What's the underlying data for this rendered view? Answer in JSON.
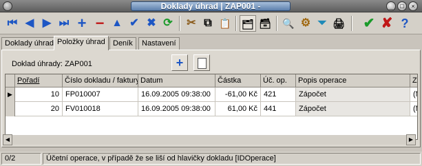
{
  "window": {
    "title": "Doklady úhrad | ZAP001 -",
    "controls": [
      "_",
      "□",
      "×"
    ]
  },
  "toolbar": {
    "buttons": [
      {
        "name": "first-record",
        "glyph": "⏮"
      },
      {
        "name": "prev-record",
        "glyph": "◀"
      },
      {
        "name": "next-record",
        "glyph": "▶"
      },
      {
        "name": "last-record",
        "glyph": "⏭"
      },
      {
        "name": "add-record",
        "glyph": "+"
      },
      {
        "name": "delete-record",
        "glyph": "−"
      },
      {
        "name": "edit-record",
        "glyph": "▲"
      },
      {
        "name": "post-record",
        "glyph": "✔"
      },
      {
        "name": "cancel-record",
        "glyph": "✖"
      },
      {
        "name": "refresh",
        "glyph": "⟳"
      },
      {
        "name": "cut",
        "glyph": "✂"
      },
      {
        "name": "copy",
        "glyph": "⧉"
      },
      {
        "name": "paste",
        "glyph": "📋"
      },
      {
        "name": "view-a",
        "glyph": "🗂"
      },
      {
        "name": "view-b",
        "glyph": "🗃"
      },
      {
        "name": "search",
        "glyph": "🔍"
      },
      {
        "name": "settings",
        "glyph": "⚙"
      },
      {
        "name": "filter",
        "glyph": "⏷"
      },
      {
        "name": "print",
        "glyph": "🖨"
      },
      {
        "name": "ok",
        "glyph": "✔"
      },
      {
        "name": "cancel",
        "glyph": "✘"
      },
      {
        "name": "help",
        "glyph": "?"
      }
    ]
  },
  "tabs": [
    {
      "label": "Doklady úhrad",
      "active": false
    },
    {
      "label": "Položky úhrad",
      "active": true
    },
    {
      "label": "Deník",
      "active": false
    },
    {
      "label": "Nastavení",
      "active": false
    }
  ],
  "panel": {
    "label": "Doklad úhrady:",
    "value": "ZAP001"
  },
  "grid": {
    "columns": [
      "Pořadí",
      "Číslo dokladu / faktury",
      "Datum",
      "Částka",
      "Úč. op.",
      "Popis operace",
      "Zp"
    ],
    "rows": [
      [
        "10",
        "FP010007",
        "16.09.2005 09:38:00",
        "-61,00 Kč",
        "421",
        "Zápočet",
        "(M"
      ],
      [
        "20",
        "FV010018",
        "16.09.2005 09:38:00",
        "61,00 Kč",
        "441",
        "Zápočet",
        "(M"
      ]
    ]
  },
  "status": {
    "counter": "0/2",
    "hint": "Účetní operace, v případě že se liší od hlavičky dokladu [IDOperace]"
  }
}
